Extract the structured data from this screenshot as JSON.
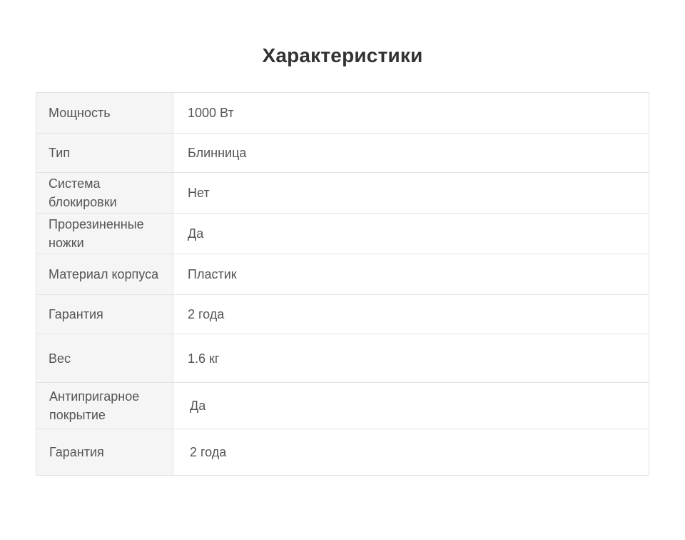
{
  "title": "Характеристики",
  "rows": [
    {
      "label": "Мощность",
      "value": "1000 Вт"
    },
    {
      "label": "Тип",
      "value": "Блинница"
    },
    {
      "label": "Система блокировки",
      "value": "Нет"
    },
    {
      "label": "Прорезиненные ножки",
      "value": "Да"
    },
    {
      "label": "Материал корпуса",
      "value": "Пластик"
    },
    {
      "label": "Гарантия",
      "value": "2 года"
    },
    {
      "label": "Вес",
      "value": "1.6 кг"
    },
    {
      "label": "Антипригарное покрытие",
      "value": "Да"
    },
    {
      "label": "Гарантия",
      "value": "2 года"
    }
  ]
}
